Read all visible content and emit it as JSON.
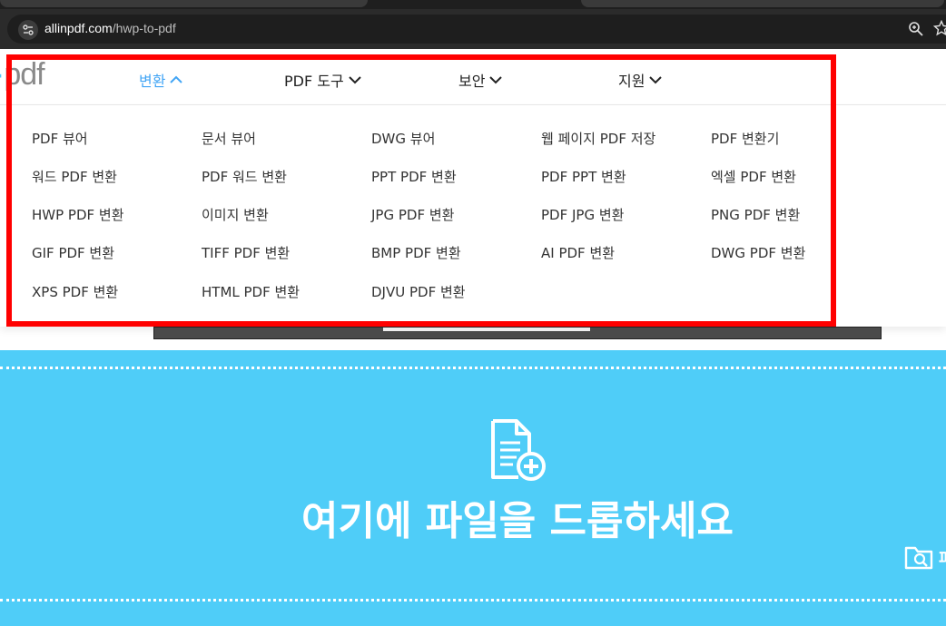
{
  "browser": {
    "url_host": "allinpdf.com",
    "url_path": "/hwp-to-pdf"
  },
  "header": {
    "logo_text": "pdf",
    "nav": [
      {
        "label": "변환"
      },
      {
        "label": "PDF 도구"
      },
      {
        "label": "보안"
      },
      {
        "label": "지원"
      }
    ]
  },
  "dropdown": {
    "items": [
      "PDF 뷰어",
      "문서 뷰어",
      "DWG 뷰어",
      "웹 페이지 PDF 저장",
      "PDF 변환기",
      "워드 PDF 변환",
      "PDF 워드 변환",
      "PPT PDF 변환",
      "PDF PPT 변환",
      "엑셀 PDF 변환",
      "HWP PDF 변환",
      "이미지 변환",
      "JPG PDF 변환",
      "PDF JPG 변환",
      "PNG PDF 변환",
      "GIF PDF 변환",
      "TIFF PDF 변환",
      "BMP PDF 변환",
      "AI PDF 변환",
      "DWG PDF 변환",
      "XPS PDF 변환",
      "HTML PDF 변환",
      "DJVU PDF 변환"
    ]
  },
  "dropzone": {
    "text": "여기에 파일을 드롭하세요",
    "folder_label": "파"
  },
  "colors": {
    "accent": "#42a5f5",
    "dropzone_bg": "#4fcdf8",
    "highlight": "#ff0000"
  }
}
